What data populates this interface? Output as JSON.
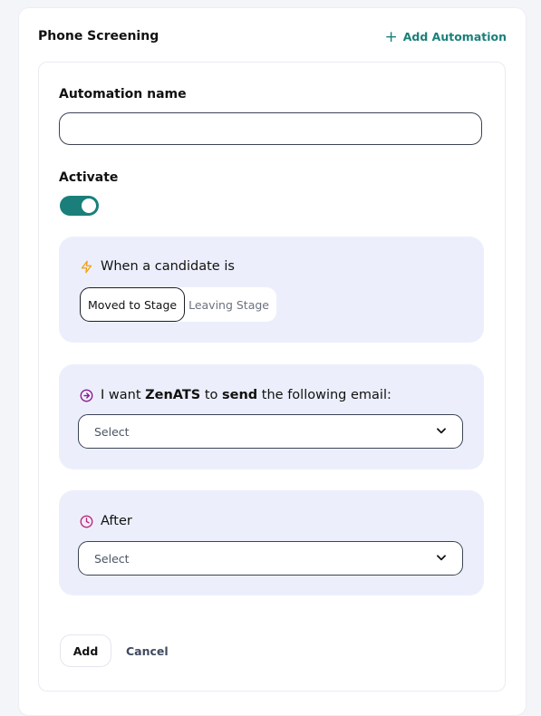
{
  "header": {
    "title": "Phone Screening",
    "add_automation_label": "Add Automation"
  },
  "form": {
    "automation_name_label": "Automation name",
    "automation_name_value": "",
    "activate_label": "Activate",
    "activate_on": true
  },
  "trigger": {
    "heading": "When a candidate is",
    "options": [
      "Moved to Stage",
      "Leaving Stage"
    ],
    "selected": "Moved to Stage"
  },
  "email": {
    "prefix": "I want",
    "brand": "ZenATS",
    "middle": "to",
    "verb": "send",
    "suffix": "the following email:",
    "select_value": "Select"
  },
  "delay": {
    "heading": "After",
    "select_value": "Select"
  },
  "actions": {
    "add_label": "Add",
    "cancel_label": "Cancel"
  },
  "colors": {
    "accent": "#1a7f7a",
    "bolt_icon": "#f59e0b",
    "arrow_icon": "#8b1a8f",
    "clock_icon": "#c0267a",
    "panel_bg": "#eceffb"
  }
}
